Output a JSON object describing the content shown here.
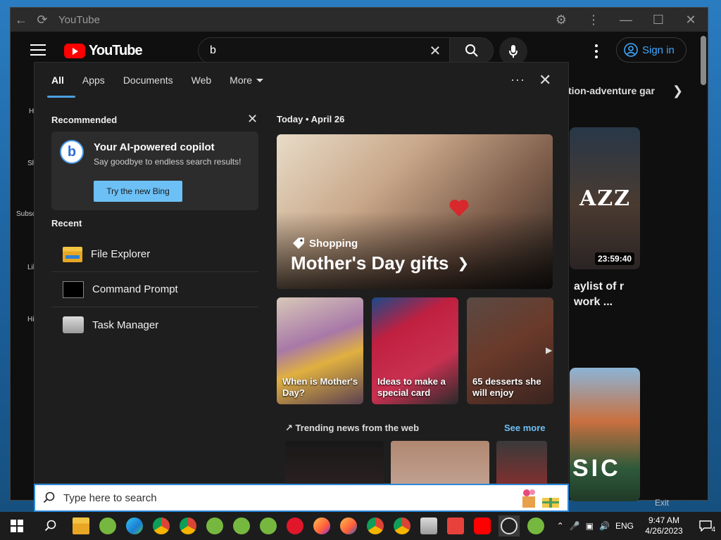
{
  "browser": {
    "title": "YouTube"
  },
  "youtube": {
    "logo_text": "YouTube",
    "search_query": "b",
    "sign_in_label": "Sign in",
    "chip_partial": "tion-adventure gar",
    "video_duration": "23:59:40",
    "video_title_partial": "aylist of r work ...",
    "thumb1_text": "AZZ",
    "thumb2_text": "SIC",
    "sidebar_partials": [
      "H",
      "Sh",
      "Subsc",
      "Lil",
      "Hi"
    ],
    "exit_label": "Exit"
  },
  "search_flyout": {
    "tabs": [
      {
        "label": "All",
        "active": true
      },
      {
        "label": "Apps",
        "active": false
      },
      {
        "label": "Documents",
        "active": false
      },
      {
        "label": "Web",
        "active": false
      },
      {
        "label": "More",
        "active": false
      }
    ],
    "recommended_heading": "Recommended",
    "bing": {
      "title": "Your AI-powered copilot",
      "subtitle": "Say goodbye to endless search results!",
      "button": "Try the new Bing",
      "logo_letter": "b"
    },
    "recent_heading": "Recent",
    "recent": [
      {
        "label": "File Explorer",
        "icon": "folder-icon"
      },
      {
        "label": "Command Prompt",
        "icon": "cmd-icon"
      },
      {
        "label": "Task Manager",
        "icon": "task-manager-icon"
      }
    ],
    "today_label": "Today",
    "today_date": "April 26",
    "hero": {
      "tag": "Shopping",
      "title": "Mother's Day gifts"
    },
    "cards": [
      {
        "label": "When is Mother's Day?"
      },
      {
        "label": "Ideas to make a special card"
      },
      {
        "label": "65 desserts she will enjoy"
      }
    ],
    "trending_heading": "Trending news from the web",
    "see_more": "See more"
  },
  "taskbar": {
    "search_placeholder": "Type here to search",
    "language": "ENG",
    "time": "9:47 AM",
    "date": "4/26/2023",
    "notification_count": "4"
  },
  "colors": {
    "accent": "#2b88d8",
    "link": "#6cc0f5",
    "yt_red": "#ff0000",
    "yt_link": "#3ea6ff"
  }
}
